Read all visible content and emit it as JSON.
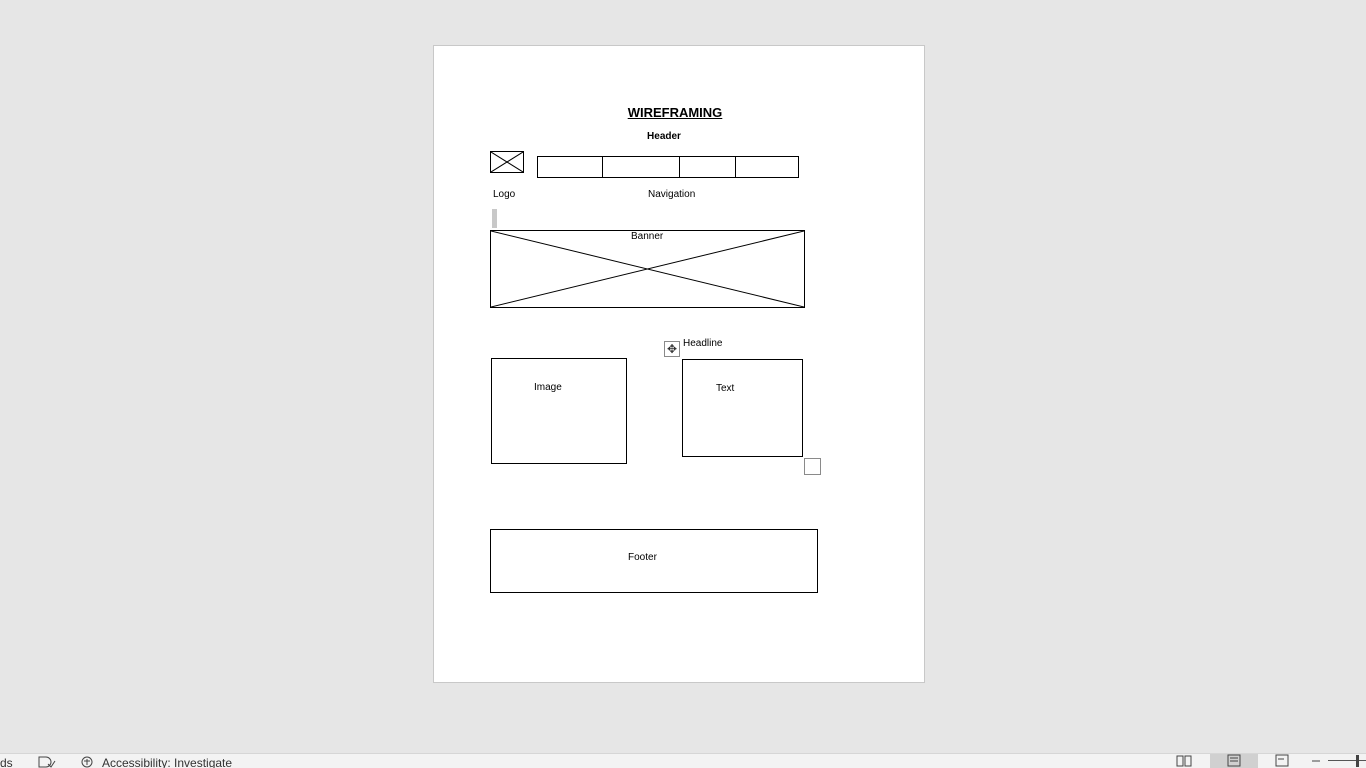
{
  "document": {
    "title": "WIREFRAMING",
    "header_label": "Header",
    "logo_label": "Logo",
    "navigation_label": "Navigation",
    "banner_label": "Banner",
    "headline_label": "Headline",
    "image_label": "Image",
    "text_label": "Text",
    "footer_label": "Footer",
    "nav_cells": 4
  },
  "statusbar": {
    "words_fragment": "ds",
    "accessibility": "Accessibility: Investigate"
  },
  "icons": {
    "proofing": "proofing-icon",
    "accessibility": "accessibility-icon",
    "read_mode": "read-mode-icon",
    "print_layout": "print-layout-icon",
    "web_layout": "web-layout-icon",
    "zoom_out": "zoom-out-icon"
  }
}
